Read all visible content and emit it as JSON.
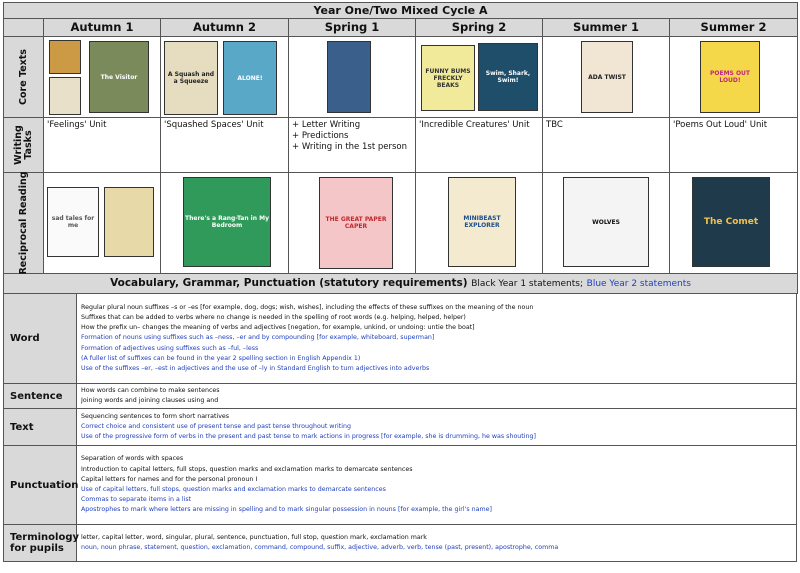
{
  "title": "Year One/Two Mixed Cycle A",
  "terms": [
    "Autumn 1",
    "Autumn 2",
    "Spring 1",
    "Spring 2",
    "Summer 1",
    "Summer 2"
  ],
  "row_labels": {
    "core": "Core Texts",
    "writing": "Writing Tasks",
    "reciprocal": "Reciprocal Reading"
  },
  "writing_tasks": {
    "a1": "'Feelings' Unit",
    "a2": "'Squashed Spaces' Unit",
    "s1": [
      "+ Letter Writing",
      "+ Predictions",
      "+ Writing in the 1st person"
    ],
    "s2": "'Incredible Creatures' Unit",
    "su1": "TBC",
    "su2": "'Poems Out Loud' Unit"
  },
  "book_titles": {
    "visitor": "The Visitor",
    "squash": "A Squash and a Squeeze",
    "alone": "ALONE!",
    "funny": "FUNNY BUMS FRECKLY BEAKS",
    "swim": "Swim, Shark, Swim!",
    "ada": "ADA TWIST",
    "poems": "POEMS OUT LOUD!",
    "sad": "sad tales for me",
    "rang": "There's a Rang-Tan in My Bedroom",
    "paper": "THE GREAT PAPER CAPER",
    "mini": "MINIBEAST EXPLORER",
    "wolves": "WOLVES",
    "comet": "The Comet"
  },
  "vgp": {
    "heading": "Vocabulary, Grammar, Punctuation (statutory requirements)",
    "y1": "Black Year 1 statements;",
    "y2": "Blue Year 2 statements"
  },
  "vgp_rows": [
    {
      "label": "Word",
      "lines": [
        {
          "t": "Regular plural noun suffixes –s or –es [for example, dog, dogs; wish, wishes], including the effects of these suffixes on the meaning of the noun",
          "c": "k"
        },
        {
          "t": "Suffixes that can be added to verbs where no change is needed in the spelling of root words (e.g. helping, helped, helper)",
          "c": "k"
        },
        {
          "t": "How the prefix un– changes the meaning of verbs and adjectives [negation, for example, unkind, or undoing: untie the boat]",
          "c": "k"
        },
        {
          "t": "Formation of nouns using suffixes such as –ness, –er and by compounding [for example, whiteboard, superman]",
          "c": "b"
        },
        {
          "t": "Formation of adjectives using suffixes such as –ful, –less",
          "c": "b"
        },
        {
          "t": "(A fuller list of suffixes can be found in the year 2 spelling section in English Appendix 1)",
          "c": "b"
        },
        {
          "t": "Use of the suffixes –er, –est in adjectives and the use of –ly in Standard English to turn adjectives into adverbs",
          "c": "b"
        }
      ]
    },
    {
      "label": "Sentence",
      "lines": [
        {
          "t": "How words can combine to make sentences",
          "c": "k"
        },
        {
          "t": "Joining words and joining clauses using and",
          "c": "k"
        }
      ]
    },
    {
      "label": "Text",
      "lines": [
        {
          "t": "Sequencing sentences to form short narratives",
          "c": "k"
        },
        {
          "t": "Correct choice and consistent use of present tense and past tense throughout writing",
          "c": "b"
        },
        {
          "t": "Use of the progressive form of verbs in the present and past tense to mark actions in progress [for example, she is drumming, he was shouting]",
          "c": "b"
        }
      ]
    },
    {
      "label": "Punctuation",
      "lines": [
        {
          "t": "Separation of words with spaces",
          "c": "k"
        },
        {
          "t": "Introduction to capital letters, full stops, question marks and exclamation marks to demarcate sentences",
          "c": "k"
        },
        {
          "t": "Capital letters for names and for the personal pronoun I",
          "c": "k"
        },
        {
          "t": "Use of capital letters, full stops, question marks and exclamation marks to demarcate sentences",
          "c": "b"
        },
        {
          "t": "Commas to separate items in a list",
          "c": "b"
        },
        {
          "t": "Apostrophes to mark where letters are missing in spelling and to mark singular possession in nouns [for example, the girl's name]",
          "c": "b"
        }
      ]
    },
    {
      "label": "Terminology for pupils",
      "lines": [
        {
          "t": "letter, capital letter, word, singular, plural, sentence, punctuation, full stop, question mark, exclamation mark",
          "c": "k"
        },
        {
          "t": "noun, noun phrase, statement, question, exclamation, command, compound, suffix, adjective, adverb, verb, tense (past, present), apostrophe, comma",
          "c": "b"
        }
      ]
    }
  ],
  "colors": {
    "header_bg": "#d9d9d9",
    "blue": "#1f3fbf"
  }
}
